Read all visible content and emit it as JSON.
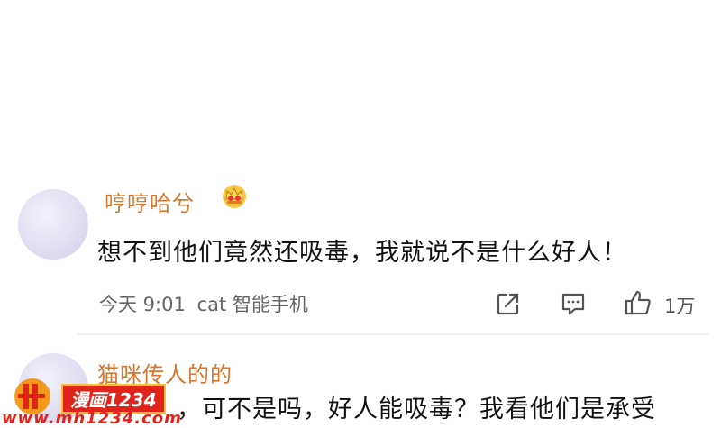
{
  "comments": [
    {
      "username": "哼哼哈兮",
      "badge_icon": "crown-icon",
      "text": "想不到他们竟然还吸毒，我就说不是什么好人！",
      "time": "今天 9:01",
      "device": "cat 智能手机",
      "actions": {
        "share_icon": "share-icon",
        "comment_icon": "comment-icon",
        "like_icon": "thumbs-up-icon",
        "like_count": "1万"
      }
    },
    {
      "username": "猫咪传人的的",
      "text_partial": "，可不是吗，好人能吸毒？我看他们是承受"
    }
  ],
  "watermark": {
    "logo_text": "漫画1234",
    "url": "www.mh1234.com"
  },
  "colors": {
    "username": "#d9762c",
    "watermark_red": "#e0241b",
    "watermark_orange": "#f39a1e"
  }
}
